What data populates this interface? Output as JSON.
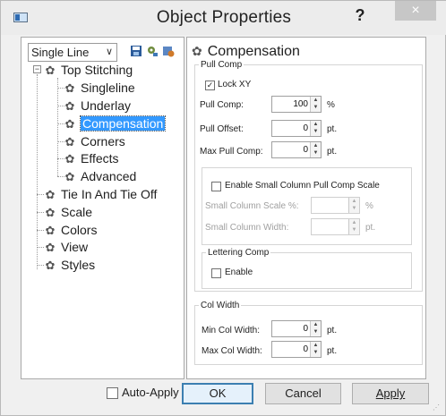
{
  "window": {
    "title": "Object Properties",
    "help_label": "?",
    "close_label": "×",
    "icon": "app-window-icon"
  },
  "toolbar": {
    "mode_value": "Single Line",
    "mode_arrow": "∨",
    "icons": [
      "save-icon",
      "gear-settings-icon",
      "properties-icon"
    ]
  },
  "tree": {
    "root": {
      "label": "Top Stitching",
      "expander": "−"
    },
    "children": [
      {
        "label": "Singleline"
      },
      {
        "label": "Underlay"
      },
      {
        "label": "Compensation",
        "selected": true
      },
      {
        "label": "Corners"
      },
      {
        "label": "Effects"
      },
      {
        "label": "Advanced"
      }
    ],
    "top_items": [
      {
        "label": "Tie In And Tie Off"
      },
      {
        "label": "Scale"
      },
      {
        "label": "Colors"
      },
      {
        "label": "View"
      },
      {
        "label": "Styles"
      }
    ]
  },
  "panel": {
    "heading": "Compensation",
    "pull_comp": {
      "legend": "Pull Comp",
      "lock_xy_label": "Lock XY",
      "lock_xy_checked": true,
      "pull_comp_label": "Pull Comp:",
      "pull_comp_value": "100",
      "pull_comp_unit": "%",
      "pull_offset_label": "Pull Offset:",
      "pull_offset_value": "0",
      "pull_offset_unit": "pt.",
      "max_pull_comp_label": "Max Pull Comp:",
      "max_pull_comp_value": "0",
      "max_pull_comp_unit": "pt."
    },
    "small_column": {
      "enable_label": "Enable Small Column Pull Comp Scale",
      "enable_checked": false,
      "scale_label": "Small Column Scale %:",
      "scale_value": "",
      "scale_unit": "%",
      "width_label": "Small Column Width:",
      "width_value": "",
      "width_unit": "pt."
    },
    "lettering_comp": {
      "legend": "Lettering Comp",
      "enable_label": "Enable",
      "enable_checked": false
    },
    "col_width": {
      "legend": "Col Width",
      "min_label": "Min Col Width:",
      "min_value": "0",
      "min_unit": "pt.",
      "max_label": "Max Col Width:",
      "max_value": "0",
      "max_unit": "pt."
    }
  },
  "footer": {
    "auto_apply_label": "Auto-Apply",
    "ok_label": "OK",
    "cancel_label": "Cancel",
    "apply_label": "Apply"
  },
  "colors": {
    "selection": "#3399ff",
    "default_button_border": "#3c7fb1"
  }
}
